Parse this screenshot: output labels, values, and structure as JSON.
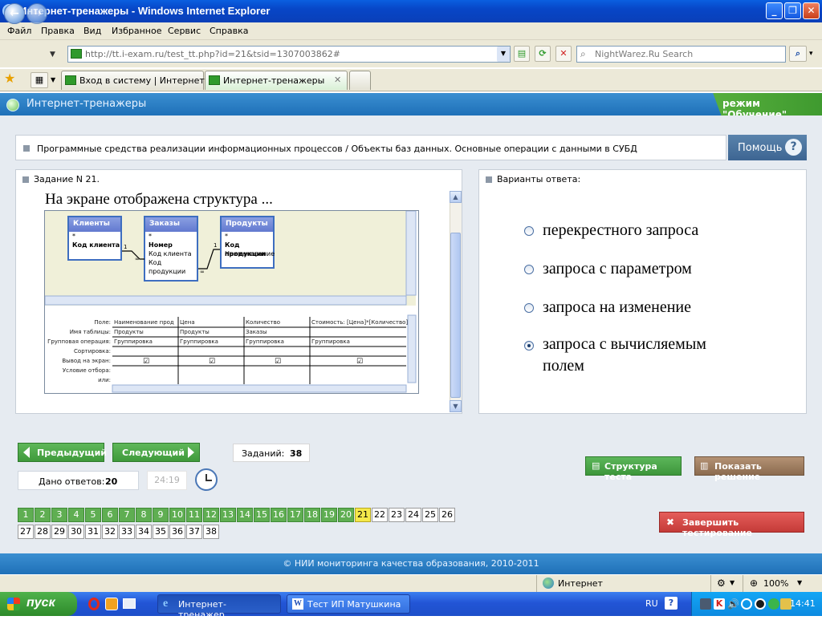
{
  "window": {
    "title": "Интернет-тренажеры - Windows Internet Explorer"
  },
  "menu": [
    "Файл",
    "Правка",
    "Вид",
    "Избранное",
    "Сервис",
    "Справка"
  ],
  "address": {
    "url": "http://tt.i-exam.ru/test_tt.php?id=21&tsid=1307003862#",
    "search_placeholder": "NightWarez.Ru Search"
  },
  "tabs": [
    {
      "label": "Вход в систему | Интернет-..."
    },
    {
      "label": "Интернет-тренажеры"
    }
  ],
  "app": {
    "name": "Интернет-тренажеры",
    "mode": "режим \"Обучение\""
  },
  "topic": "Программные средства реализации информационных процессов / Объекты баз данных. Основные операции с данными в СУБД",
  "help_label": "Помощь",
  "question": {
    "header": "Задание N 21.",
    "text": "На экране отображена структура ...",
    "tables": [
      {
        "title": "Клиенты",
        "rows": [
          "*",
          "Код клиента"
        ]
      },
      {
        "title": "Заказы",
        "rows": [
          "*",
          "Номер",
          "Код клиента",
          "Код продукции"
        ]
      },
      {
        "title": "Продукты",
        "rows": [
          "*",
          "Код продукции",
          "Наименование"
        ]
      }
    ],
    "grid_captions": [
      "Поле:",
      "Имя таблицы:",
      "Групповая операция:",
      "Сортировка:",
      "Вывод на экран:",
      "Условие отбора:",
      "или:"
    ],
    "grid_columns": [
      {
        "field": "Наименование прод",
        "table": "Продукты",
        "group": "Группировка"
      },
      {
        "field": "Цена",
        "table": "Продукты",
        "group": "Группировка"
      },
      {
        "field": "Количество",
        "table": "Заказы",
        "group": "Группировка"
      },
      {
        "field": "Стоимость: [Цена]*[Количество]",
        "table": "",
        "group": "Группировка"
      }
    ]
  },
  "answers": {
    "header": "Варианты ответа:",
    "options": [
      {
        "text": "перекрестного  запроса",
        "selected": false
      },
      {
        "text": "запроса с параметром",
        "selected": false
      },
      {
        "text": "запроса на изменение",
        "selected": false
      },
      {
        "text": "запроса с вычисляемым полем",
        "selected": true
      }
    ]
  },
  "controls": {
    "prev": "Предыдущий",
    "next": "Следующий",
    "tasks_label": "Заданий:",
    "tasks_count": "38",
    "answered_label": "Дано ответов:",
    "answered_count": "20",
    "timer": "24:19",
    "structure": "Структура теста",
    "solution": "Показать решение",
    "finish": "Завершить тестирование"
  },
  "task_numbers": {
    "total": 38,
    "current": 21,
    "done_until": 20
  },
  "footer": "© НИИ мониторинга качества образования, 2010-2011",
  "status": {
    "zone": "Интернет",
    "zoom": "100%"
  },
  "taskbar": {
    "start": "пуск",
    "items": [
      "Интернет-тренажер...",
      "Тест ИП Матушкина ..."
    ],
    "lang": "RU",
    "time": "14:41"
  },
  "colors": {
    "accent_blue": "#1f70b8",
    "green": "#3f9a3b",
    "red": "#c43b38",
    "current_task": "#f5e84a"
  }
}
